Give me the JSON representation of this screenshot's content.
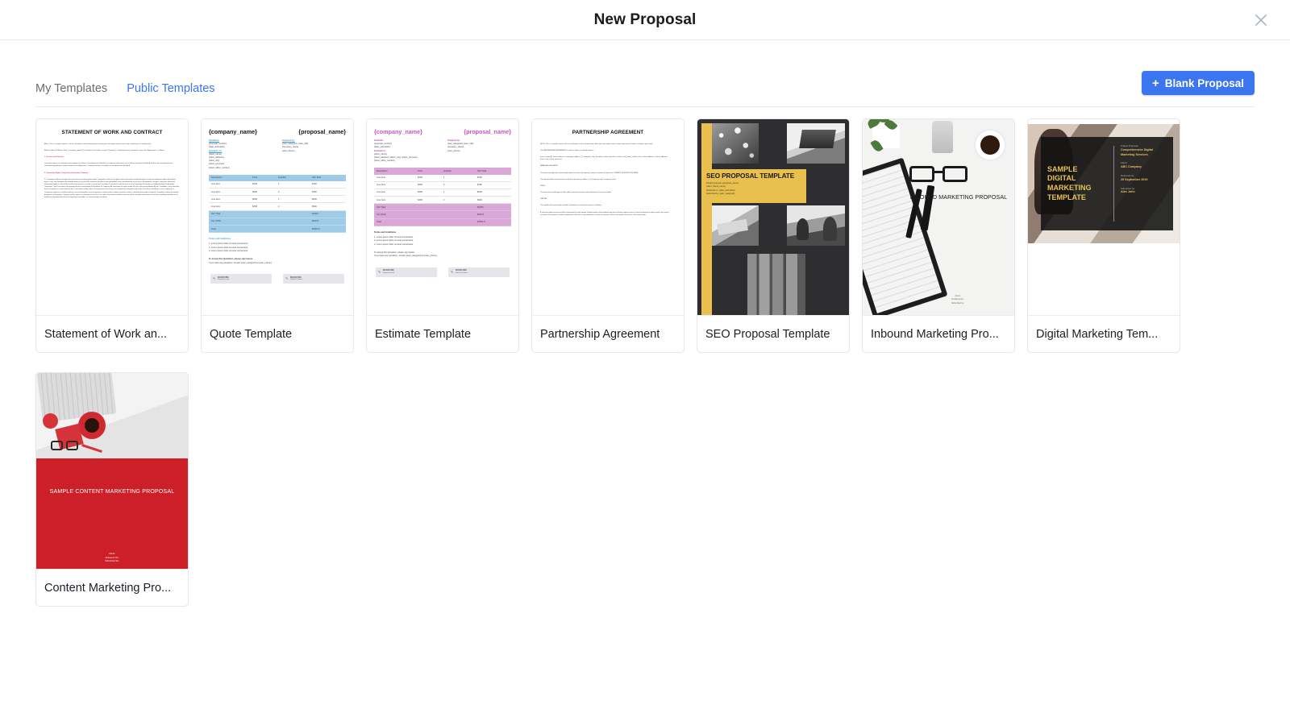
{
  "header": {
    "title": "New Proposal",
    "close_icon": "close-icon"
  },
  "toolbar": {
    "tabs": [
      {
        "label": "My Templates",
        "active": false
      },
      {
        "label": "Public Templates",
        "active": true
      }
    ],
    "blank_button": {
      "plus": "+",
      "label": "Blank Proposal",
      "color": "#3b76ef"
    }
  },
  "cards": [
    {
      "title": "Statement of Work an...",
      "kind": "doc-sow"
    },
    {
      "title": "Quote Template",
      "kind": "quote-blue"
    },
    {
      "title": "Estimate Template",
      "kind": "quote-pink"
    },
    {
      "title": "Partnership Agreement",
      "kind": "doc-partnership"
    },
    {
      "title": "SEO Proposal Template",
      "kind": "seo"
    },
    {
      "title": "Inbound Marketing Pro...",
      "kind": "inbound"
    },
    {
      "title": "Digital Marketing Tem...",
      "kind": "digital"
    },
    {
      "title": "Content Marketing Pro...",
      "kind": "content"
    }
  ],
  "thumbs": {
    "sow": {
      "heading": "STATEMENT OF WORK AND CONTRACT",
      "p1": "[Note: This is a sample contract - we are not lawyers and recommend you having your own legal counsel review any contract prior to sending out.]",
      "p2": "Effective [date] (\"Effective Date\"), {company_name} (\"Consultant\") and {client_name} (\"Company\"), a [state/province] corporation, agree that \"Agreement\" as follows:",
      "h_services": "1. Services and Payment",
      "p3": "Consultant agrees to undertake and complete the Services (as defined in Exhibit A) in accordance with and on the schedule specified in Exhibit A. As the only consideration due Consultant regarding the subject matter of this Agreement, Company will pay Consultant in accordance with Exhibit A.",
      "h_ownership": "2. Ownership; Rights; Proprietary Information; Publicity",
      "p4": "2.1  Company shall own all right, title and interest (including patent rights, copyrights, trade secret rights, mask work rights, trademark rights, sui generis database rights and all other rights of any sort throughout the world) relating to any and all inventions (whether or not patentable), works of authorship, mask works, designations, designs, know-how, ideas and information made or conceived or reduced to practice, in whole or in part, by Consultant in connection with Services or any Proprietary Information (as defined below) (collectively, \"Inventions\") and Consultant will promptly disclose and provide all Inventions to Company. All Inventions are works made for hire to the extent allowed by law. In addition, if any Invention does not qualify as a work made for hire, Consultant hereby makes all assignments necessary to accomplish the foregoing ownership. Consultant shall further assist Company, at Company's expense, to further evidence, record and perfect such assignments, and to perfect, obtain, maintain, enforce, and defend any rights assigned. Consultant hereby irrevocably designates and appoints Company and its agents as attorneys in fact to act for and in Consultant's behalf to execute and file any document and to do all other lawfully permitted acts to further the foregoing with the same legal force and effect as if executed by Consultant."
    },
    "partnership": {
      "heading": "PARTNERSHIP AGREEMENT",
      "p1": "NOTE: This is a sample contract. We are not lawyers and recommend you have your own legal counsel review any contracts before sending to your client.",
      "p2": "This PARTNERSHIP AGREEMENT is made on {date_accepted} between",
      "p3": "{user_assigned}, whose address is {company_address_1}, {company_city}, {company_state} and {client_contact_first} {client_contact_last}, whose address is {client_address}, {client_city}, {client_province}.",
      "h1": "NAME AND BUSINESS",
      "p4": "The parties hereby form a partnership under the name of {company_name} to conduct the business of INSERT DESCRIPTION HERE.",
      "p5": "The principal office of the business shall be at {company_address_2}, {company_city}, {company_state}",
      "h2": "TERM",
      "p6": "The partnership shall begin on {due_date}, and shall continue until terminated as herein provided.",
      "h3": "CAPITAL",
      "p7": "The capital of the partnership shall be contributed in cash by the partners as follows:",
      "p8": "A separate capital account shall be maintained for each partner. Neither partner shall withdraw any part of his/her capital account. Upon the demand of either partner, the capital accounts of the partners shall be maintained at all times in the proportions in which the partners share in the profits and losses of the partnership."
    },
    "quote": {
      "company": "{company_name}",
      "proposal": "{proposal_name}",
      "label_left": "Quotation:",
      "left_lines": [
        "{proposal_number}",
        "{date_submitted}"
      ],
      "label_to": "Quotation to:",
      "to_lines": [
        "{client_name}",
        "{client_address},",
        "{client_city},",
        "{client_province}",
        "{client_office_number}"
      ],
      "label_prepared": "Prepared by:",
      "prepared_lines": [
        "{user_assigned}, {user_title}",
        "{company_name}",
        "{user_phone}"
      ],
      "columns": [
        "Description",
        "Price",
        "Quantity",
        "Sub Total"
      ],
      "rows": [
        [
          "Line Item",
          "$100",
          "1",
          "$100"
        ],
        [
          "Line Item",
          "$250",
          "3",
          "$750"
        ],
        [
          "Line Item",
          "$200",
          "1",
          "$200"
        ],
        [
          "Line Item",
          "$150",
          "2",
          "$300"
        ]
      ],
      "summary": [
        [
          "Sub Total",
          "",
          "",
          "$1350"
        ],
        [
          "Tax (15%)",
          "",
          "",
          "$202.5"
        ],
        [
          "Total",
          "",
          "",
          "$1552.5"
        ]
      ],
      "terms_title": "Terms and Conditions",
      "terms": [
        "1. Lorem ipsum dolor sit amet consectetur.",
        "2. Lorem ipsum dolor sit amet consectetur.",
        "3. Lorem ipsum dolor sit amet consectetur."
      ],
      "accept_1": "To accept this Quotation, please sign below.",
      "accept_2": "If you have any questions, contact {user_assigned} at {user_phone}.",
      "signatures": [
        {
          "title": "SIGNATURE",
          "sub": "Proposal Lead"
        },
        {
          "title": "SIGNATURE",
          "sub": "Default Contact"
        }
      ]
    },
    "estimate": {
      "company": "{company_name}",
      "proposal": "{proposal_name}",
      "label_left": "Estimate:",
      "left_lines": [
        "{proposal_number}",
        "{date_submitted}"
      ],
      "label_to": "Estimate to:",
      "to_lines": [
        "{client_name}",
        "{client_address}, {client_city}, {client_province}",
        "{client_office_number}"
      ],
      "label_prepared": "Prepared by:",
      "prepared_lines": [
        "{user_assigned}, {user_title}",
        "{company_name}",
        "{user_phone}"
      ],
      "columns": [
        "Description",
        "Price",
        "Quantity",
        "Sub Total"
      ],
      "rows": [
        [
          "Line Item",
          "$100",
          "1",
          "$100"
        ],
        [
          "Line Item",
          "$250",
          "3",
          "$750"
        ],
        [
          "Line Item",
          "$200",
          "1",
          "$200"
        ],
        [
          "Line Item",
          "$150",
          "2",
          "$300"
        ]
      ],
      "summary": [
        [
          "Sub Total",
          "",
          "",
          "$1350"
        ],
        [
          "Tax (15%)",
          "",
          "",
          "$202.5"
        ],
        [
          "Total",
          "",
          "",
          "$1552.5"
        ]
      ],
      "terms_title": "Terms and Conditions",
      "terms": [
        "1. Lorem ipsum dolor sit amet consectetur.",
        "2. Lorem ipsum dolor sit amet consectetur.",
        "3. Lorem ipsum dolor sit amet consectetur."
      ],
      "accept_1": "To accept this Quotation, please sign below.",
      "accept_2": "If you have any questions, contact {user_assigned} at {user_phone}.",
      "signatures": [
        {
          "title": "SIGNATURE",
          "sub": "Proposal Lead"
        },
        {
          "title": "SIGNATURE",
          "sub": "Default Contact"
        }
      ]
    },
    "seo": {
      "title": "SEO PROPOSAL TEMPLATE",
      "meta": [
        "Project proposal: {proposal_name}",
        "Client: {client_name}",
        "Delivered on: {date_submitted}",
        "Submitted by: {user_assigned}"
      ],
      "accent": "#e9bf4e"
    },
    "inbound": {
      "title": "INBOUND MARKETING PROPOSAL",
      "meta": [
        "Client:",
        "Delivered by:",
        "Submitted by:"
      ]
    },
    "digital": {
      "title": "SAMPLE DIGITAL MARKETING TEMPLATE",
      "fields": [
        {
          "label": "Project Proposal:",
          "value": "Comprehensive Digital Marketing Services"
        },
        {
          "label": "Client:",
          "value": "ABC Company"
        },
        {
          "label": "Delivered on:",
          "value": "25 September 2019"
        },
        {
          "label": "Submitted by:",
          "value": "Alex John"
        }
      ],
      "accent": "#e9c257"
    },
    "content": {
      "title": "SAMPLE CONTENT MARKETING PROPOSAL",
      "meta": [
        "Client:",
        "Delivered On:",
        "Submitted By:"
      ],
      "accent": "#cd1f27"
    }
  }
}
